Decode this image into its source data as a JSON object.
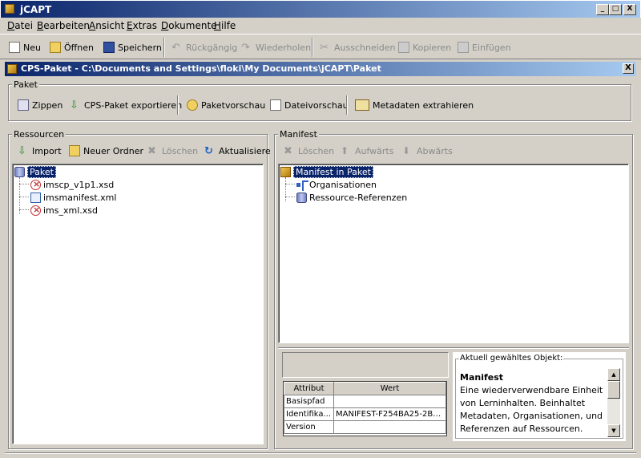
{
  "window": {
    "title": "jCAPT",
    "min": "_",
    "max": "□",
    "close": "X"
  },
  "menu": [
    "Datei",
    "Bearbeiten",
    "Ansicht",
    "Extras",
    "Dokumente",
    "Hilfe"
  ],
  "toolbar": {
    "new": "Neu",
    "open": "Öffnen",
    "save": "Speichern",
    "undo": "Rückgängig",
    "redo": "Wiederholen",
    "cut": "Ausschneiden",
    "copy": "Kopieren",
    "paste": "Einfügen"
  },
  "doc": {
    "title": "CPS-Paket - C:\\Documents and Settings\\floki\\My Documents\\jCAPT\\Paket",
    "close": "X"
  },
  "paket": {
    "label": "Paket",
    "zip": "Zippen",
    "export": "CPS-Paket exportieren",
    "preview": "Paketvorschau",
    "filepreview": "Dateivorschau",
    "metadata": "Metadaten extrahieren"
  },
  "resources": {
    "label": "Ressourcen",
    "import": "Import",
    "newfolder": "Neuer Ordner",
    "delete": "Löschen",
    "refresh": "Aktualisiere",
    "tree": {
      "root": "Paket",
      "files": [
        "imscp_v1p1.xsd",
        "imsmanifest.xml",
        "ims_xml.xsd"
      ]
    }
  },
  "manifest": {
    "label": "Manifest",
    "delete": "Löschen",
    "up": "Aufwärts",
    "down": "Abwärts",
    "tree": {
      "root": "Manifest in Paket",
      "children": [
        "Organisationen",
        "Ressource-Referenzen"
      ]
    },
    "table": {
      "headers": [
        "Attribut",
        "Wert"
      ],
      "rows": [
        [
          "Basispfad",
          ""
        ],
        [
          "Identifika...",
          "MANIFEST-F254BA25-2BD..."
        ],
        [
          "Version",
          ""
        ]
      ]
    },
    "info": {
      "label": "Aktuell gewähltes Objekt:",
      "heading": "Manifest",
      "text": "Eine wiederverwendbare Einheit von Lerninhalten. Beinhaltet Metadaten, Organisationen, und Referenzen auf Ressourcen."
    }
  }
}
